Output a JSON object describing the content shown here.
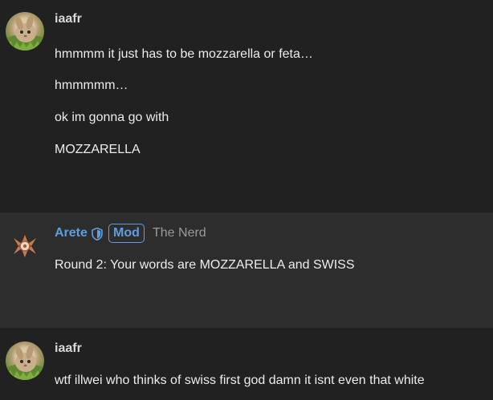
{
  "messages": [
    {
      "author": "iaafr",
      "avatar_icon": "bunny-avatar",
      "lines": [
        "hmmmm it just has to be mozzarella or feta…",
        "hmmmmm…",
        "ok im gonna go with",
        "MOZZARELLA"
      ]
    },
    {
      "author": "Arete",
      "avatar_icon": "arete-avatar",
      "badge": "Mod",
      "title": "The Nerd",
      "lines": [
        "Round 2: Your words are MOZZARELLA and SWISS"
      ]
    },
    {
      "author": "iaafr",
      "avatar_icon": "bunny-avatar",
      "lines": [
        "wtf illwei who thinks of swiss first god damn it isnt even that white"
      ]
    }
  ],
  "colors": {
    "background": "#212121",
    "highlight_background": "#2d2d2d",
    "mod_accent": "#5d9ee2",
    "text": "#ececec",
    "muted": "#9a9a9a"
  }
}
